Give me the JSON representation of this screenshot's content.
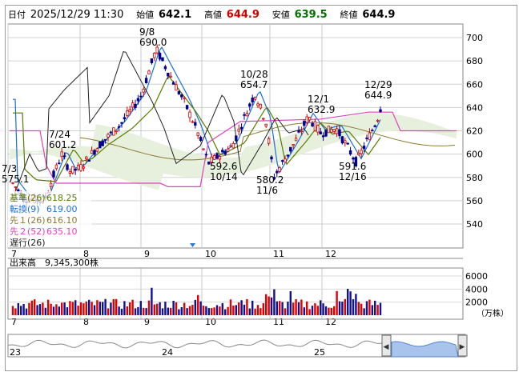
{
  "header": {
    "date_label": "日付",
    "datetime": "2025/12/29 11:30",
    "open_label": "始値",
    "open": "642.1",
    "high_label": "高値",
    "high": "644.9",
    "low_label": "安値",
    "low": "639.5",
    "close_label": "終値",
    "close": "644.9"
  },
  "colors": {
    "up": "#d00000",
    "down": "#000090",
    "kijun": "#5a7a00",
    "tenkan": "#1a6fd8",
    "senkou1": "#8a7a30",
    "senkou2": "#e040c0",
    "chikou": "#222222",
    "cloud": "#e6f0dc"
  },
  "indicator_legend": [
    {
      "label": "基準(26)",
      "value": "618.25",
      "color": "#5a7a00"
    },
    {
      "label": "転換(9)",
      "value": "619.00",
      "color": "#1a6fd8"
    },
    {
      "label": "先１(26)",
      "value": "616.10",
      "color": "#8a7a30"
    },
    {
      "label": "先２(52)",
      "value": "635.10",
      "color": "#e040c0"
    },
    {
      "label": "遅行(26)",
      "value": "",
      "color": "#222222"
    }
  ],
  "price_axis": {
    "ticks": [
      "700",
      "680",
      "660",
      "640",
      "620",
      "600",
      "580",
      "560",
      "540"
    ]
  },
  "month_labels": [
    "7",
    "8",
    "9",
    "10",
    "11",
    "12"
  ],
  "annotations": [
    {
      "date": "7/3",
      "price": "575.1"
    },
    {
      "date": "7/24",
      "price": "601.2"
    },
    {
      "date": "9/8",
      "price": "690.0"
    },
    {
      "date": "10/14",
      "price": "592.6"
    },
    {
      "date": "10/28",
      "price": "654.7"
    },
    {
      "date": "11/6",
      "price": "580.2"
    },
    {
      "date": "12/1",
      "price": "632.9"
    },
    {
      "date": "12/16",
      "price": "591.6"
    },
    {
      "date": "12/29",
      "price": "644.9"
    }
  ],
  "volume": {
    "label": "出来高",
    "value": "9,345,300株",
    "ticks": [
      "6000",
      "4000",
      "2000"
    ],
    "unit": "（万株）"
  },
  "navigator": {
    "labels": [
      "23",
      "24",
      "25"
    ],
    "left_arrow": "◀",
    "right_arrow": "▶"
  },
  "chart_data": {
    "type": "candlestick",
    "price_range": [
      530,
      710
    ],
    "volume_range_10k_shares": [
      0,
      7000
    ],
    "x_labels": [
      "7",
      "8",
      "9",
      "10",
      "11",
      "12"
    ],
    "key_points": [
      {
        "date": "7/3",
        "price": 575.1
      },
      {
        "date": "7/24",
        "price": 601.2
      },
      {
        "date": "9/8",
        "price": 690.0
      },
      {
        "date": "10/14",
        "price": 592.6
      },
      {
        "date": "10/28",
        "price": 654.7
      },
      {
        "date": "11/6",
        "price": 580.2
      },
      {
        "date": "12/1",
        "price": 632.9
      },
      {
        "date": "12/16",
        "price": 591.6
      },
      {
        "date": "12/29",
        "price": 644.9
      }
    ],
    "last": {
      "open": 642.1,
      "high": 644.9,
      "low": 639.5,
      "close": 644.9
    },
    "indicators": {
      "kijun_26": 618.25,
      "tenkan_9": 619.0,
      "senkou1_26": 616.1,
      "senkou2_52": 635.1
    }
  }
}
